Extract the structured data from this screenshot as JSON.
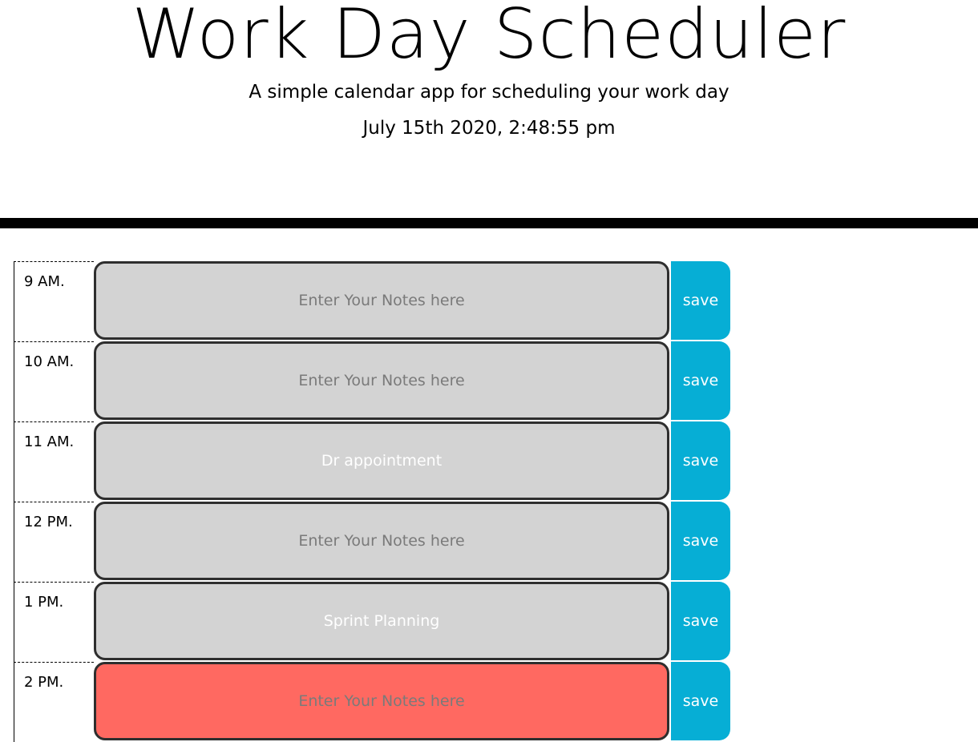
{
  "header": {
    "title": "Work Day Scheduler",
    "subtitle": "A simple calendar app for scheduling your work day",
    "current_day": "July 15th 2020, 2:48:55 pm"
  },
  "colors": {
    "past": "#d3d3d3",
    "present": "#ff6961",
    "save_button": "#06aed5"
  },
  "time_blocks": [
    {
      "hour": "9 AM.",
      "note": "",
      "placeholder": "Enter Your Notes here",
      "save_label": "save",
      "state": "past"
    },
    {
      "hour": "10 AM.",
      "note": "",
      "placeholder": "Enter Your Notes here",
      "save_label": "save",
      "state": "past"
    },
    {
      "hour": "11 AM.",
      "note": "Dr appointment",
      "placeholder": "Enter Your Notes here",
      "save_label": "save",
      "state": "past"
    },
    {
      "hour": "12 PM.",
      "note": "",
      "placeholder": "Enter Your Notes here",
      "save_label": "save",
      "state": "past"
    },
    {
      "hour": "1 PM.",
      "note": "Sprint Planning",
      "placeholder": "Enter Your Notes here",
      "save_label": "save",
      "state": "past"
    },
    {
      "hour": "2 PM.",
      "note": "",
      "placeholder": "Enter Your Notes here",
      "save_label": "save",
      "state": "present"
    }
  ]
}
